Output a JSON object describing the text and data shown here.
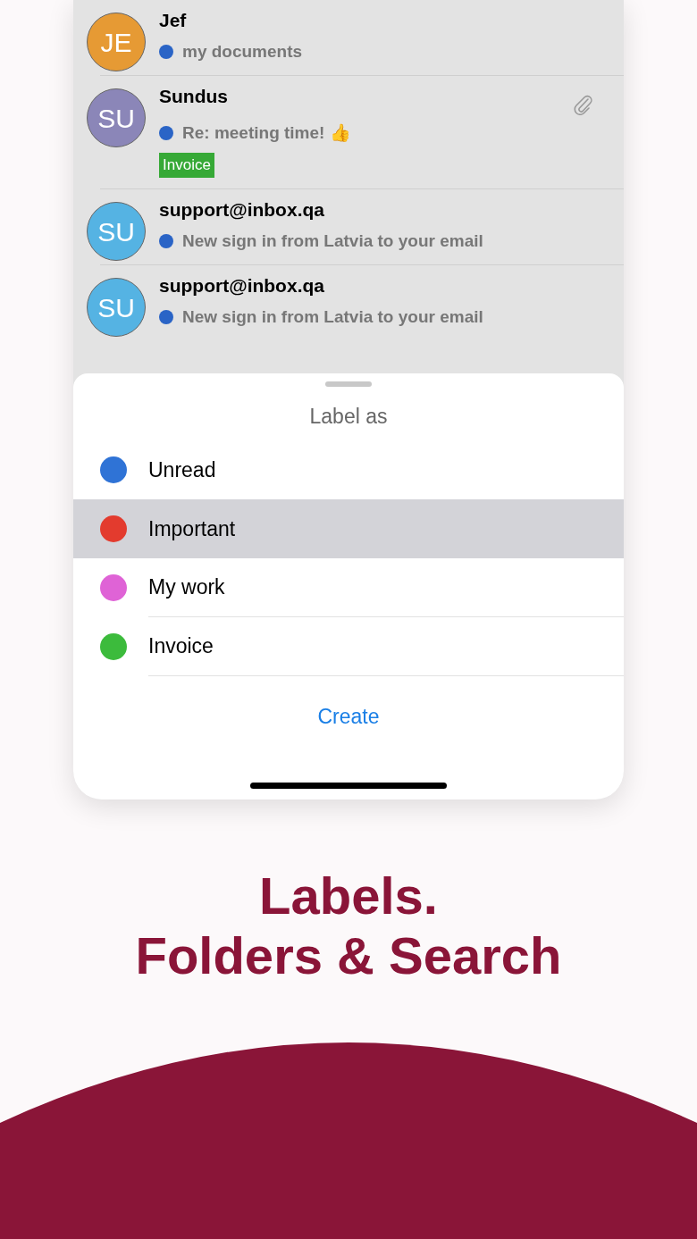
{
  "messages": [
    {
      "initials": "JE",
      "color": "#e69a34",
      "sender": "Jef",
      "subject": "my documents",
      "unread": true,
      "attachment": false
    },
    {
      "initials": "SU",
      "color": "#8b86b8",
      "sender": "Sundus",
      "subject": "Re: meeting time! 👍",
      "unread": true,
      "attachment": true,
      "tags": [
        {
          "text": "Invoice",
          "color": "#36a936"
        }
      ]
    },
    {
      "initials": "SU",
      "color": "#55b3e3",
      "sender": "support@inbox.qa",
      "subject": "New sign in from Latvia to your email",
      "unread": true,
      "attachment": false
    },
    {
      "initials": "SU",
      "color": "#55b3e3",
      "sender": "support@inbox.qa",
      "subject": "New sign in from Latvia to your email",
      "unread": true,
      "attachment": false
    }
  ],
  "sheet": {
    "title": "Label as",
    "labels": [
      {
        "name": "Unread",
        "color": "#2f73d6",
        "selected": false
      },
      {
        "name": "Important",
        "color": "#e33b2e",
        "selected": true
      },
      {
        "name": "My work",
        "color": "#df63d6",
        "selected": false
      },
      {
        "name": "Invoice",
        "color": "#3cbb3c",
        "selected": false
      }
    ],
    "action": "Create"
  },
  "headline": [
    "Labels.",
    "Folders & Search"
  ]
}
